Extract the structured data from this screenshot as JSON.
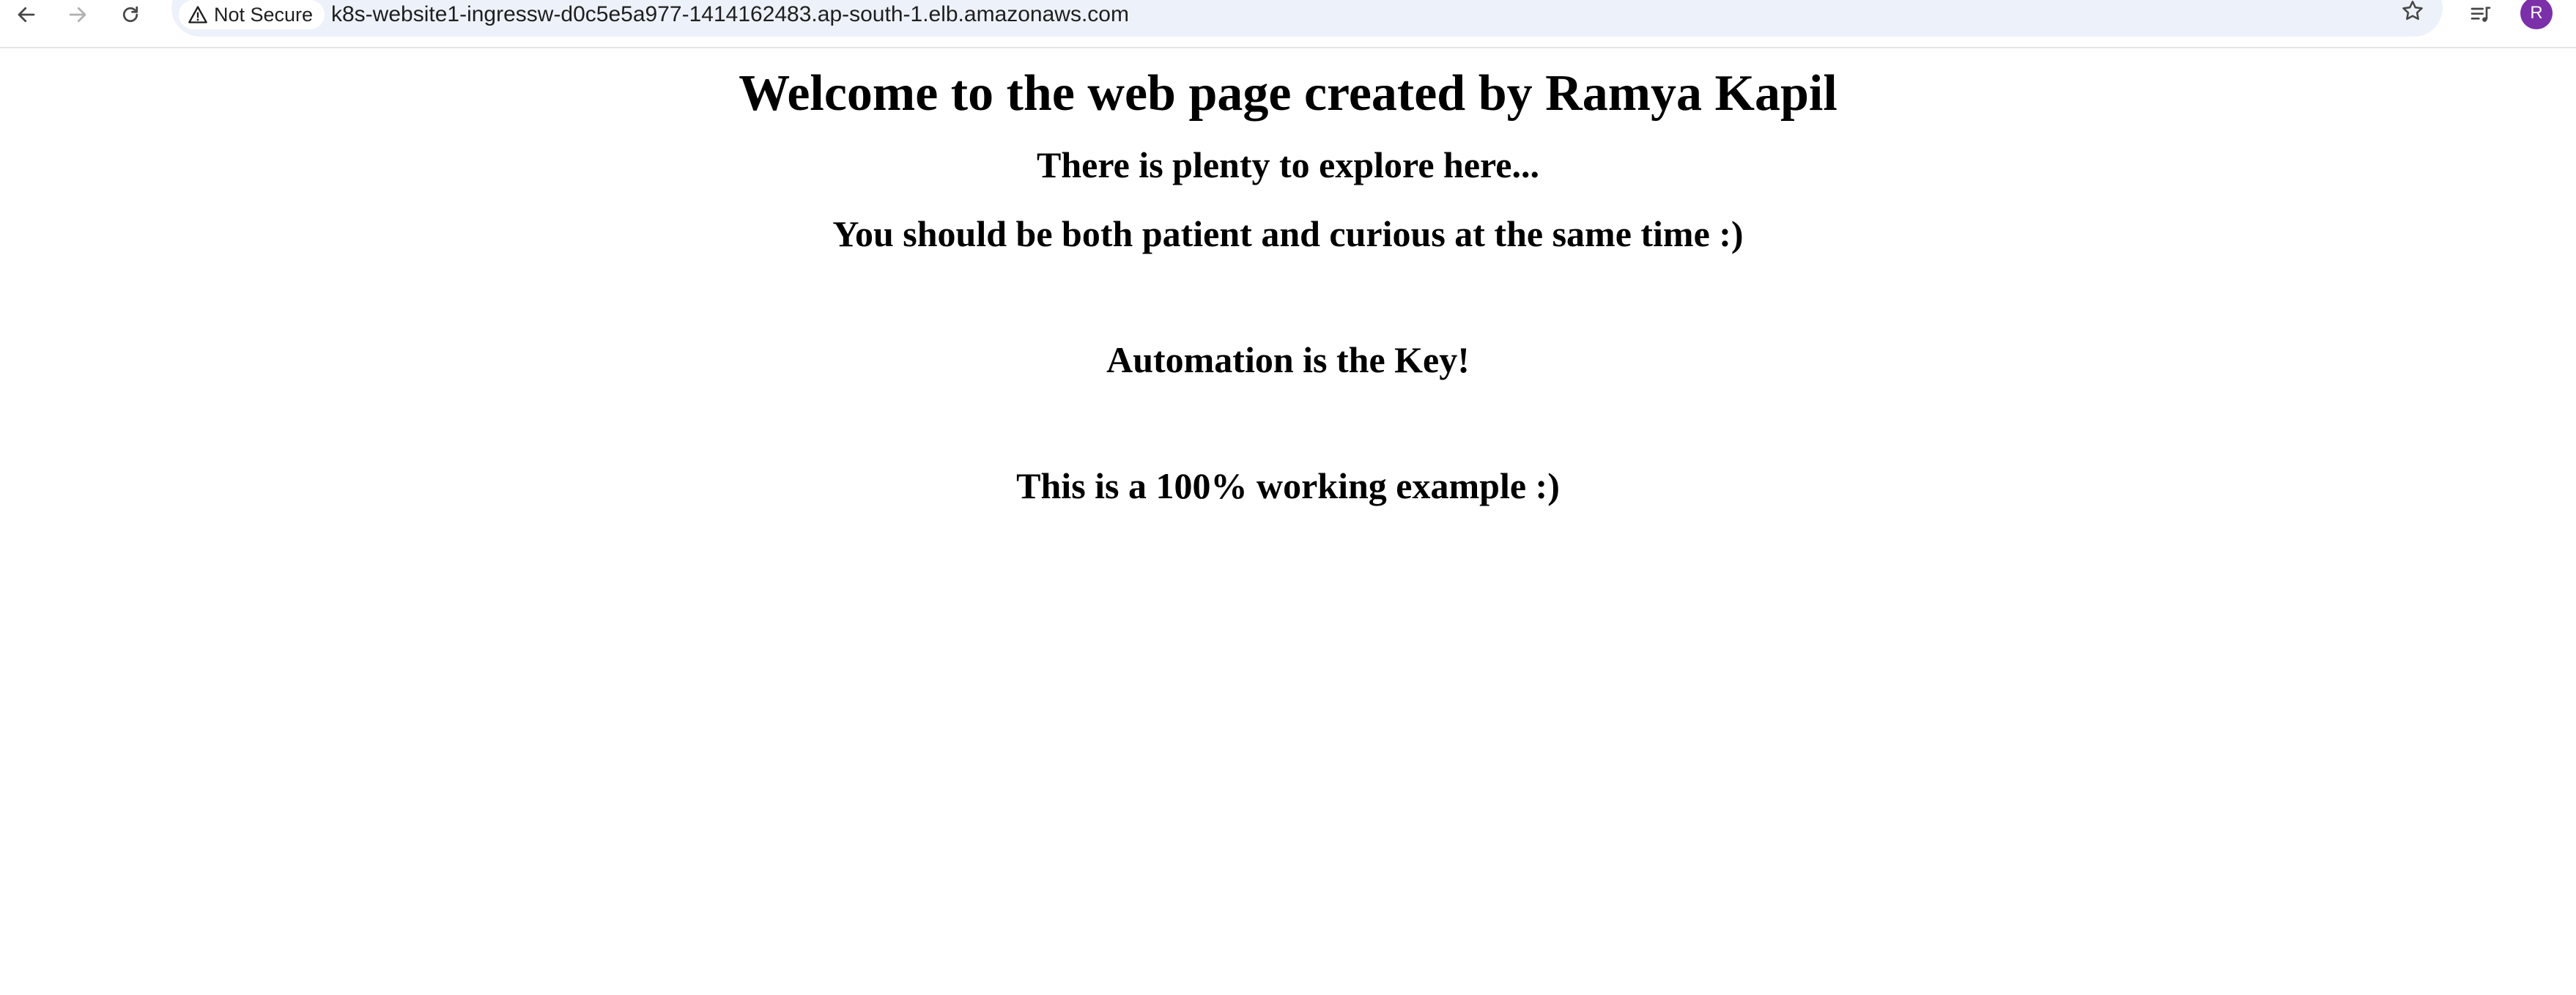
{
  "browser": {
    "security_label": "Not Secure",
    "url": "k8s-website1-ingressw-d0c5e5a977-1414162483.ap-south-1.elb.amazonaws.com",
    "profile_initial": "R",
    "profile_color": "#7b2fa8",
    "icons": {
      "back": "back-arrow-icon",
      "forward": "forward-arrow-icon",
      "reload": "reload-icon",
      "warning": "warning-triangle-icon",
      "bookmark": "star-icon",
      "media": "media-control-icon"
    }
  },
  "page": {
    "title": "Welcome to the web page created by Ramya Kapil",
    "line1": "There is plenty to explore here...",
    "line2": "You should be both patient and curious at the same time :)",
    "line3": "Automation is the Key!",
    "line4": "This is a 100% working example :)"
  }
}
